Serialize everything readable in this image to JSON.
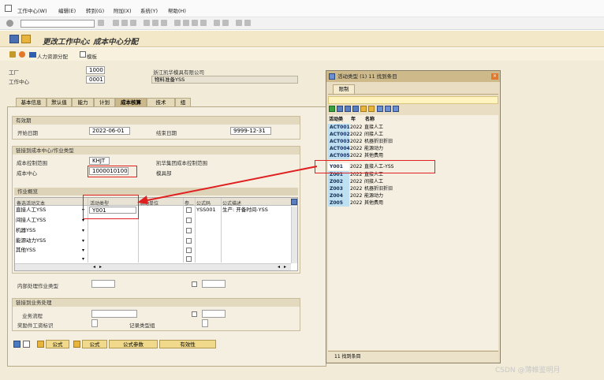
{
  "menu": {
    "items": [
      "工作中心(W)",
      "编辑(E)",
      "转到(G)",
      "附加(X)",
      "系统(Y)",
      "帮助(H)"
    ]
  },
  "header": {
    "title": "更改工作中心: 成本中心分配",
    "hr_button": "人力资源分配",
    "template_label": "模板"
  },
  "fields": {
    "plant_label": "工厂",
    "plant_value": "1000",
    "plant_desc": "浙江凯华模具有限公司",
    "wc_label": "工作中心",
    "wc_value": "0001",
    "wc_desc": "物料准备YSS"
  },
  "tabs": [
    "基本信息",
    "默认值",
    "能力",
    "计划",
    "成本核算",
    "技术",
    "组"
  ],
  "validity": {
    "header": "有效期",
    "start_label": "开始日期",
    "start_value": "2022-06-01",
    "end_label": "结束日期",
    "end_value": "9999-12-31"
  },
  "costcenter": {
    "header": "链接到成本中心/作业类型",
    "area_label": "成本控制范围",
    "area_value": "KHJT",
    "area_desc": "凯华集团成本控制范围",
    "cc_label": "成本中心",
    "cc_value": "1000010100",
    "cc_desc": "模具部"
  },
  "activities": {
    "header": "作业概览",
    "columns": [
      "备选活动文本",
      "活动类型",
      "活动单位",
      "参...",
      "公式码",
      "公式描述"
    ],
    "rows": [
      {
        "text": "直接人工YSS",
        "type": "Y001",
        "unit": "",
        "formula": "YSS001",
        "desc": "生产: 开备时间-YSS"
      },
      {
        "text": "间接人工YSS",
        "type": "",
        "unit": "",
        "formula": "",
        "desc": ""
      },
      {
        "text": "机器YSS",
        "type": "",
        "unit": "",
        "formula": "",
        "desc": ""
      },
      {
        "text": "能源动力YSS",
        "type": "",
        "unit": "",
        "formula": "",
        "desc": ""
      },
      {
        "text": "其他YSS",
        "type": "",
        "unit": "",
        "formula": "",
        "desc": ""
      },
      {
        "text": "",
        "type": "",
        "unit": "",
        "formula": "",
        "desc": ""
      },
      {
        "text": "",
        "type": "",
        "unit": "",
        "formula": "",
        "desc": ""
      }
    ]
  },
  "internal": {
    "label": "内部处理作业类型"
  },
  "business": {
    "header": "链接到业务处理",
    "process_label": "业务流程",
    "incentive_label": "奖励件工资标识",
    "record_label": "记录类型组"
  },
  "bottom_buttons": [
    "公式",
    "公式",
    "公式参数",
    "有效性"
  ],
  "popup": {
    "title": "活动类型 (1)  11 找到条目",
    "tab": "限制",
    "col_code": "活动类",
    "col_year": "年",
    "col_name": "名称",
    "rows": [
      {
        "code": "ACT001",
        "year": "2022",
        "name": "直接人工"
      },
      {
        "code": "ACT002",
        "year": "2022",
        "name": "间接人工"
      },
      {
        "code": "ACT003",
        "year": "2022",
        "name": "机器折旧折旧"
      },
      {
        "code": "ACT004",
        "year": "2022",
        "name": "能源动力"
      },
      {
        "code": "ACT005",
        "year": "2022",
        "name": "其他费用"
      },
      {
        "code": "Y001",
        "year": "2022",
        "name": "直接人工-YSS"
      },
      {
        "code": "Z001",
        "year": "2022",
        "name": "直接人工"
      },
      {
        "code": "Z002",
        "year": "2022",
        "name": "间接人工"
      },
      {
        "code": "Z003",
        "year": "2022",
        "name": "机器折旧折旧"
      },
      {
        "code": "Z004",
        "year": "2022",
        "name": "能源动力"
      },
      {
        "code": "Z005",
        "year": "2022",
        "name": "其他费用"
      }
    ],
    "status": "11 找到条目"
  },
  "watermark": "CSDN @薄帷鉴明月",
  "colors": {
    "highlight": "#e02020",
    "popup_code_bg": "#bfe0f1",
    "title_bg": "#f3e9c8"
  }
}
